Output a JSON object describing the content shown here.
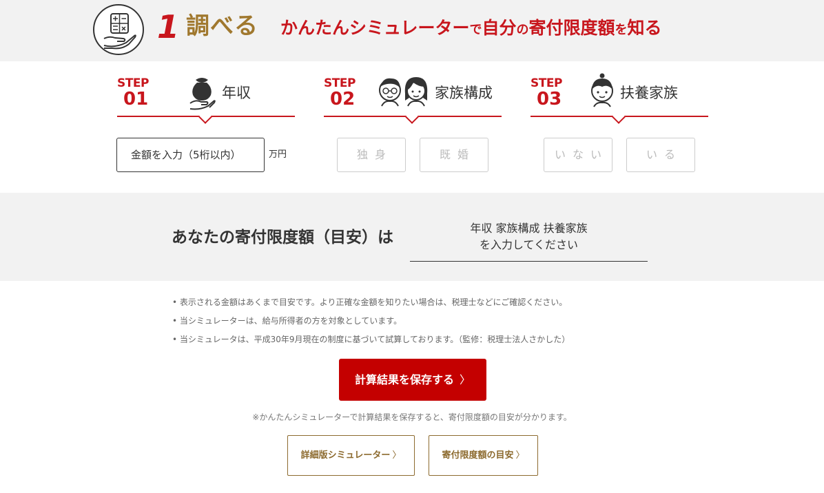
{
  "header": {
    "step_number": "1",
    "title": "調べる",
    "subtitle_parts": [
      "かんたんシミュレーター",
      "で",
      "自分",
      "の",
      "寄付限度額",
      "を",
      "知る"
    ],
    "icon": "calculator-hand-icon"
  },
  "steps": [
    {
      "word": "STEP",
      "num": "01",
      "label": "年収",
      "icon": "money-bag-hand-icon"
    },
    {
      "word": "STEP",
      "num": "02",
      "label": "家族構成",
      "icon": "couple-icon"
    },
    {
      "word": "STEP",
      "num": "03",
      "label": "扶養家族",
      "icon": "child-icon"
    }
  ],
  "income": {
    "placeholder": "金額を入力（5桁以内）",
    "value": "",
    "unit": "万円"
  },
  "family_options": [
    "独身",
    "既婚"
  ],
  "dependent_options": [
    "いない",
    "いる"
  ],
  "result": {
    "label": "あなたの寄付限度額（目安）は",
    "value_line1": "年収 家族構成 扶養家族",
    "value_line2": "を入力してください"
  },
  "notes": [
    "• 表示される金額はあくまで目安です。より正確な金額を知りたい場合は、税理士などにご確認ください。",
    "• 当シミュレーターは、給与所得者の方を対象としています。",
    "• 当シミュレータは、平成30年9月現在の制度に基づいて試算しております。（監修：税理士法人さかした）"
  ],
  "save_button": {
    "label": "計算結果を保存する",
    "chevron": "〉"
  },
  "save_note": "※かんたんシミュレーターで計算結果を保存すると、寄付限度額の目安が分かります。",
  "sub_buttons": [
    {
      "label": "詳細版シミュレーター",
      "chevron": "〉"
    },
    {
      "label": "寄付限度額の目安",
      "chevron": "〉"
    }
  ],
  "colors": {
    "red": "#c8161d",
    "gold": "#a0782e",
    "button_red": "#c40000",
    "band": "#f2f2f2"
  }
}
